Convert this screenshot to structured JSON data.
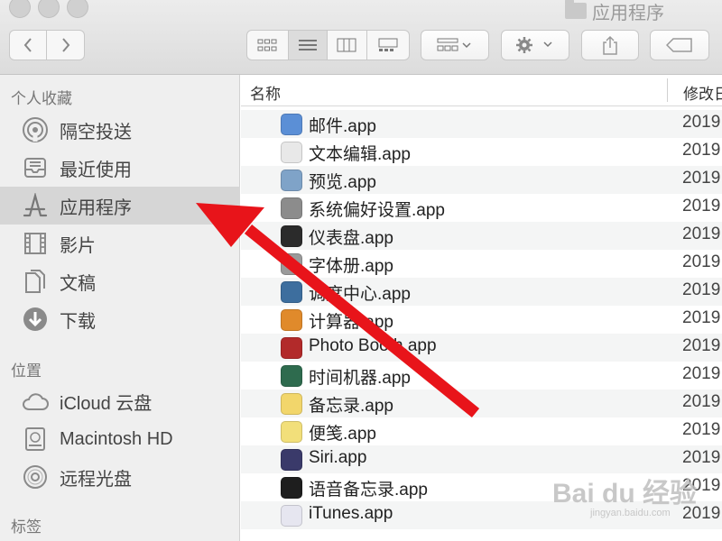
{
  "window": {
    "title": "应用程序"
  },
  "toolbar": {
    "back_icon": "chevron-left-icon",
    "forward_icon": "chevron-right-icon",
    "view_modes": [
      "icon-view-icon",
      "list-view-icon",
      "column-view-icon",
      "gallery-view-icon"
    ],
    "active_view": "list-view-icon",
    "group_icon": "group-by-icon",
    "action_icon": "gear-icon",
    "share_icon": "share-icon",
    "tag_icon": "tag-icon"
  },
  "sidebar": {
    "favorites_header": "个人收藏",
    "favorites": [
      {
        "label": "隔空投送",
        "icon": "airdrop-icon"
      },
      {
        "label": "最近使用",
        "icon": "recents-icon"
      },
      {
        "label": "应用程序",
        "icon": "applications-icon",
        "active": true
      },
      {
        "label": "影片",
        "icon": "movies-icon"
      },
      {
        "label": "文稿",
        "icon": "documents-icon"
      },
      {
        "label": "下载",
        "icon": "downloads-icon"
      }
    ],
    "locations_header": "位置",
    "locations": [
      {
        "label": "iCloud 云盘",
        "icon": "icloud-icon"
      },
      {
        "label": "Macintosh HD",
        "icon": "hard-drive-icon"
      },
      {
        "label": "远程光盘",
        "icon": "remote-disc-icon"
      }
    ],
    "tags_header": "标签"
  },
  "list": {
    "col_name": "名称",
    "col_modified": "修改日",
    "rows": [
      {
        "name": "邮件.app",
        "date": "2019",
        "icon": "mail-app-icon",
        "color": "#5b8fd6"
      },
      {
        "name": "文本编辑.app",
        "date": "2019",
        "icon": "textedit-app-icon",
        "color": "#e8e8e8"
      },
      {
        "name": "预览.app",
        "date": "2019",
        "icon": "preview-app-icon",
        "color": "#7fa3c8"
      },
      {
        "name": "系统偏好设置.app",
        "date": "2019",
        "icon": "system-preferences-app-icon",
        "color": "#8c8c8c"
      },
      {
        "name": "仪表盘.app",
        "date": "2019",
        "icon": "dashboard-app-icon",
        "color": "#2b2b2b"
      },
      {
        "name": "字体册.app",
        "date": "2019",
        "icon": "font-book-app-icon",
        "color": "#9a9a9a"
      },
      {
        "name": "调度中心.app",
        "date": "2019",
        "icon": "mission-control-app-icon",
        "color": "#3d6e9e"
      },
      {
        "name": "计算器.app",
        "date": "2019",
        "icon": "calculator-app-icon",
        "color": "#e08a2b"
      },
      {
        "name": "Photo Booth.app",
        "date": "2019",
        "icon": "photo-booth-app-icon",
        "color": "#b22a2a"
      },
      {
        "name": "时间机器.app",
        "date": "2019",
        "icon": "time-machine-app-icon",
        "color": "#2e6b4e"
      },
      {
        "name": "备忘录.app",
        "date": "2019",
        "icon": "notes-app-icon",
        "color": "#f2d66b"
      },
      {
        "name": "便笺.app",
        "date": "2019",
        "icon": "stickies-app-icon",
        "color": "#f2df7a"
      },
      {
        "name": "Siri.app",
        "date": "2019",
        "icon": "siri-app-icon",
        "color": "#3a3a6a"
      },
      {
        "name": "语音备忘录.app",
        "date": "2019",
        "icon": "voice-memos-app-icon",
        "color": "#1e1e1e"
      },
      {
        "name": "iTunes.app",
        "date": "2019",
        "icon": "itunes-app-icon",
        "color": "#e6e6f0"
      }
    ]
  },
  "watermark": {
    "text": "Bai du 经验",
    "sub": "jingyan.baidu.com"
  },
  "annotation": {
    "arrow_color": "#e8141a"
  }
}
